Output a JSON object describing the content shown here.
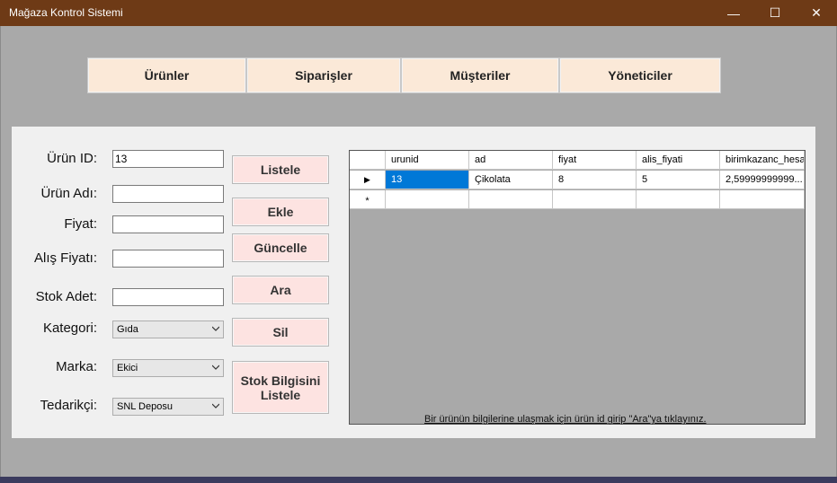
{
  "window": {
    "title": "Mağaza Kontrol Sistemi",
    "minimize": "—",
    "maximize": "☐",
    "close": "✕"
  },
  "nav": {
    "urunler": "Ürünler",
    "siparisler": "Siparişler",
    "musteriler": "Müşteriler",
    "yoneticiler": "Yöneticiler"
  },
  "form": {
    "urun_id_label": "Ürün ID:",
    "urun_id_value": "13",
    "urun_adi_label": "Ürün Adı:",
    "urun_adi_value": "",
    "fiyat_label": "Fiyat:",
    "fiyat_value": "",
    "alis_fiyati_label": "Alış Fiyatı:",
    "alis_fiyati_value": "",
    "stok_adet_label": "Stok Adet:",
    "stok_adet_value": "",
    "kategori_label": "Kategori:",
    "kategori_value": "Gıda",
    "marka_label": "Marka:",
    "marka_value": "Ekici",
    "tedarikci_label": "Tedarikçi:",
    "tedarikci_value": "SNL Deposu"
  },
  "actions": {
    "listele": "Listele",
    "ekle": "Ekle",
    "guncelle": "Güncelle",
    "ara": "Ara",
    "sil": "Sil",
    "stok_line1": "Stok Bilgisini",
    "stok_line2": "Listele"
  },
  "grid": {
    "columns": [
      "urunid",
      "ad",
      "fiyat",
      "alis_fiyati",
      "birimkazanc_hesa"
    ],
    "row": [
      "13",
      "Çikolata",
      "8",
      "5",
      "2,59999999999..."
    ],
    "current_row_marker": "▶",
    "new_row_marker": "*"
  },
  "hint": "Bir ürünün bilgilerine ulaşmak için ürün id girip \"Ara\"ya tıklayınız."
}
